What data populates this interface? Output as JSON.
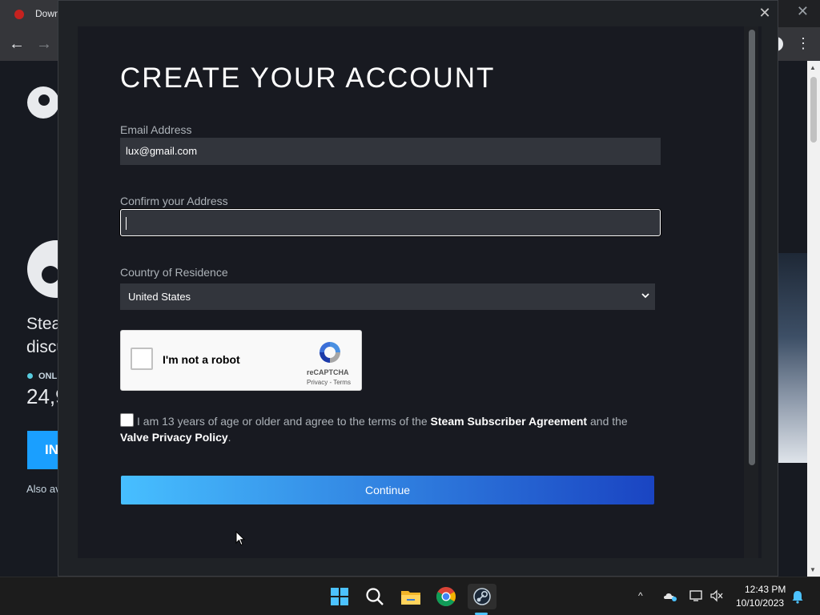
{
  "browser": {
    "tab_title": "Down",
    "close_glyph": "✕",
    "back_glyph": "←",
    "forward_glyph": "→",
    "menu_glyph": "⋮"
  },
  "background_page": {
    "hero_text_line1": "Stea",
    "hero_text_line2": "discu",
    "online_label": "ONLI",
    "online_count": "24,9",
    "install_label": "IN",
    "also_text": "Also av"
  },
  "modal": {
    "close_glyph": "✕",
    "title": "CREATE YOUR ACCOUNT",
    "email": {
      "label": "Email Address",
      "value": "lux@gmail.com"
    },
    "confirm": {
      "label": "Confirm your Address",
      "value": ""
    },
    "country": {
      "label": "Country of Residence",
      "selected": "United States"
    },
    "captcha": {
      "label": "I'm not a robot",
      "brand": "reCAPTCHA",
      "links": "Privacy - Terms"
    },
    "agreement": {
      "text_1": "I am 13 years of age or older and agree to the terms of the ",
      "link_ssa": "Steam Subscriber Agreement",
      "text_2": " and the ",
      "link_privacy": "Valve Privacy Policy",
      "text_3": "."
    },
    "continue_label": "Continue"
  },
  "taskbar": {
    "tray_chevron": "^",
    "time": "12:43 PM",
    "date": "10/10/2023"
  },
  "colors": {
    "modal_bg": "#181a21",
    "field_bg": "#32353c",
    "button_start": "#47bfff",
    "button_end": "#1a44c2",
    "accent": "#4cc2ff"
  }
}
